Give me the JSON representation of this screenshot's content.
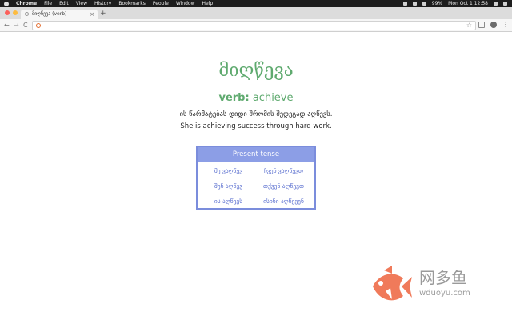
{
  "menubar": {
    "app_name": "Chrome",
    "menus": [
      "File",
      "Edit",
      "View",
      "History",
      "Bookmarks",
      "People",
      "Window",
      "Help"
    ],
    "battery": "99%",
    "clock": "Mon Oct 1 12:58"
  },
  "browser": {
    "tab_title": "მიღწევა (verb)",
    "tab_close": "×",
    "new_tab": "+",
    "back": "←",
    "forward": "→",
    "reload": "C",
    "star": "☆"
  },
  "page": {
    "headword": "მიღწევა",
    "pos_label": "verb:",
    "translation": "achieve",
    "georgian_example": "ის წარმატებას დიდი შრომის შედეგად აღწევს.",
    "english_example": "She is achieving success through hard work."
  },
  "conjugation": {
    "header": "Present tense",
    "rows": [
      [
        "მე ვაღწევ",
        "ჩვენ ვაღწევთ"
      ],
      [
        "შენ აღწევ",
        "თქვენ აღწევთ"
      ],
      [
        "ის აღწევს",
        "ისინი აღწევენ"
      ]
    ]
  },
  "watermark": {
    "brand_cn": "网多鱼",
    "url": "wduoyu.com"
  },
  "colors": {
    "accent_green": "#5faa6f",
    "table_blue": "#7b8ddc",
    "table_header": "#8c9ee6",
    "fish_orange": "#f07a5a"
  }
}
